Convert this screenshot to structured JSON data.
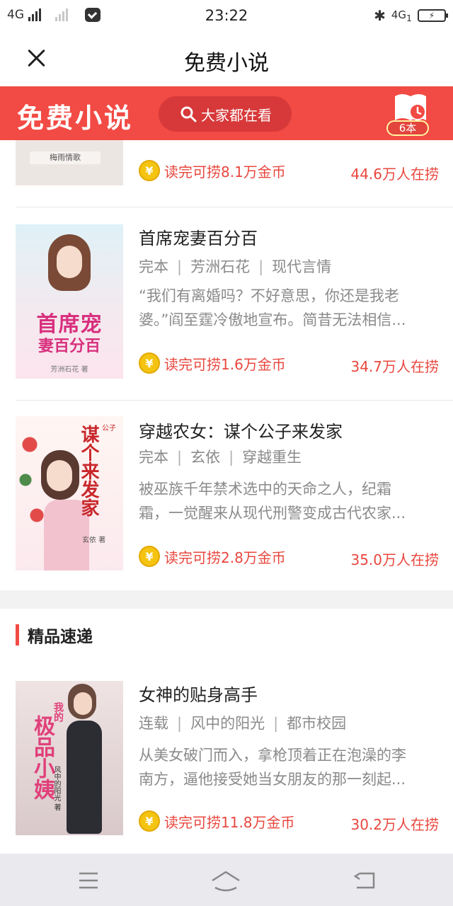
{
  "status_bar": {
    "network_left": "4G",
    "time": "23:22",
    "network_right": "4G",
    "network_right_sub": "1"
  },
  "header": {
    "title": "免费小说"
  },
  "banner": {
    "brand": "免费小说",
    "search_label": "大家都在看",
    "shelf_count": "6本"
  },
  "books": [
    {
      "cover_alt": "梅雨情歌",
      "coins": "读完可捞8.1万金币",
      "readers": "44.6万人在捞",
      "cover_color": "#ece6e3"
    },
    {
      "title": "首席宠妻百分百",
      "status": "完本",
      "author": "芳洲石花",
      "genre": "现代言情",
      "desc1": "“我们有离婚吗？不好意思，你还是我老",
      "desc2": "婆。”阎至霆冷傲地宣布。简昔无法相信...",
      "coins": "读完可捞1.6万金币",
      "readers": "34.7万人在捞",
      "cover_title": "首席宠",
      "cover_sub": "妻百分百",
      "cover_author": "芳洲石花 著",
      "cover_color": "#dff1f7"
    },
    {
      "title": "穿越农女：谋个公子来发家",
      "status": "完本",
      "author": "玄依",
      "genre": "穿越重生",
      "desc1": "被巫族千年禁术选中的天命之人，纪霜",
      "desc2": "霜，一觉醒来从现代刑警变成古代农家...",
      "coins": "读完可捞2.8万金币",
      "readers": "35.0万人在捞",
      "cover_title": "谋个来发家",
      "cover_badge": "公子",
      "cover_author": "玄依 著",
      "cover_color": "#fbe9ee"
    }
  ],
  "section": {
    "title": "精品速递"
  },
  "featured": {
    "title": "女神的贴身高手",
    "status": "连载",
    "author": "风中的阳光",
    "genre": "都市校园",
    "desc1": "从美女破门而入，拿枪顶着正在泡澡的李",
    "desc2": "南方，逼他接受她当女朋友的那一刻起...",
    "coins": "读完可捞11.8万金币",
    "readers": "30.2万人在捞",
    "cover_title": "极品小姨",
    "cover_badge": "我的",
    "cover_author": "风中的阳光 著",
    "cover_color": "#f0e4e6"
  },
  "coin_symbol": "¥",
  "colors": {
    "brand_red": "#f24a44",
    "coin_gold": "#f4c410",
    "accent_text": "#e8473e"
  }
}
